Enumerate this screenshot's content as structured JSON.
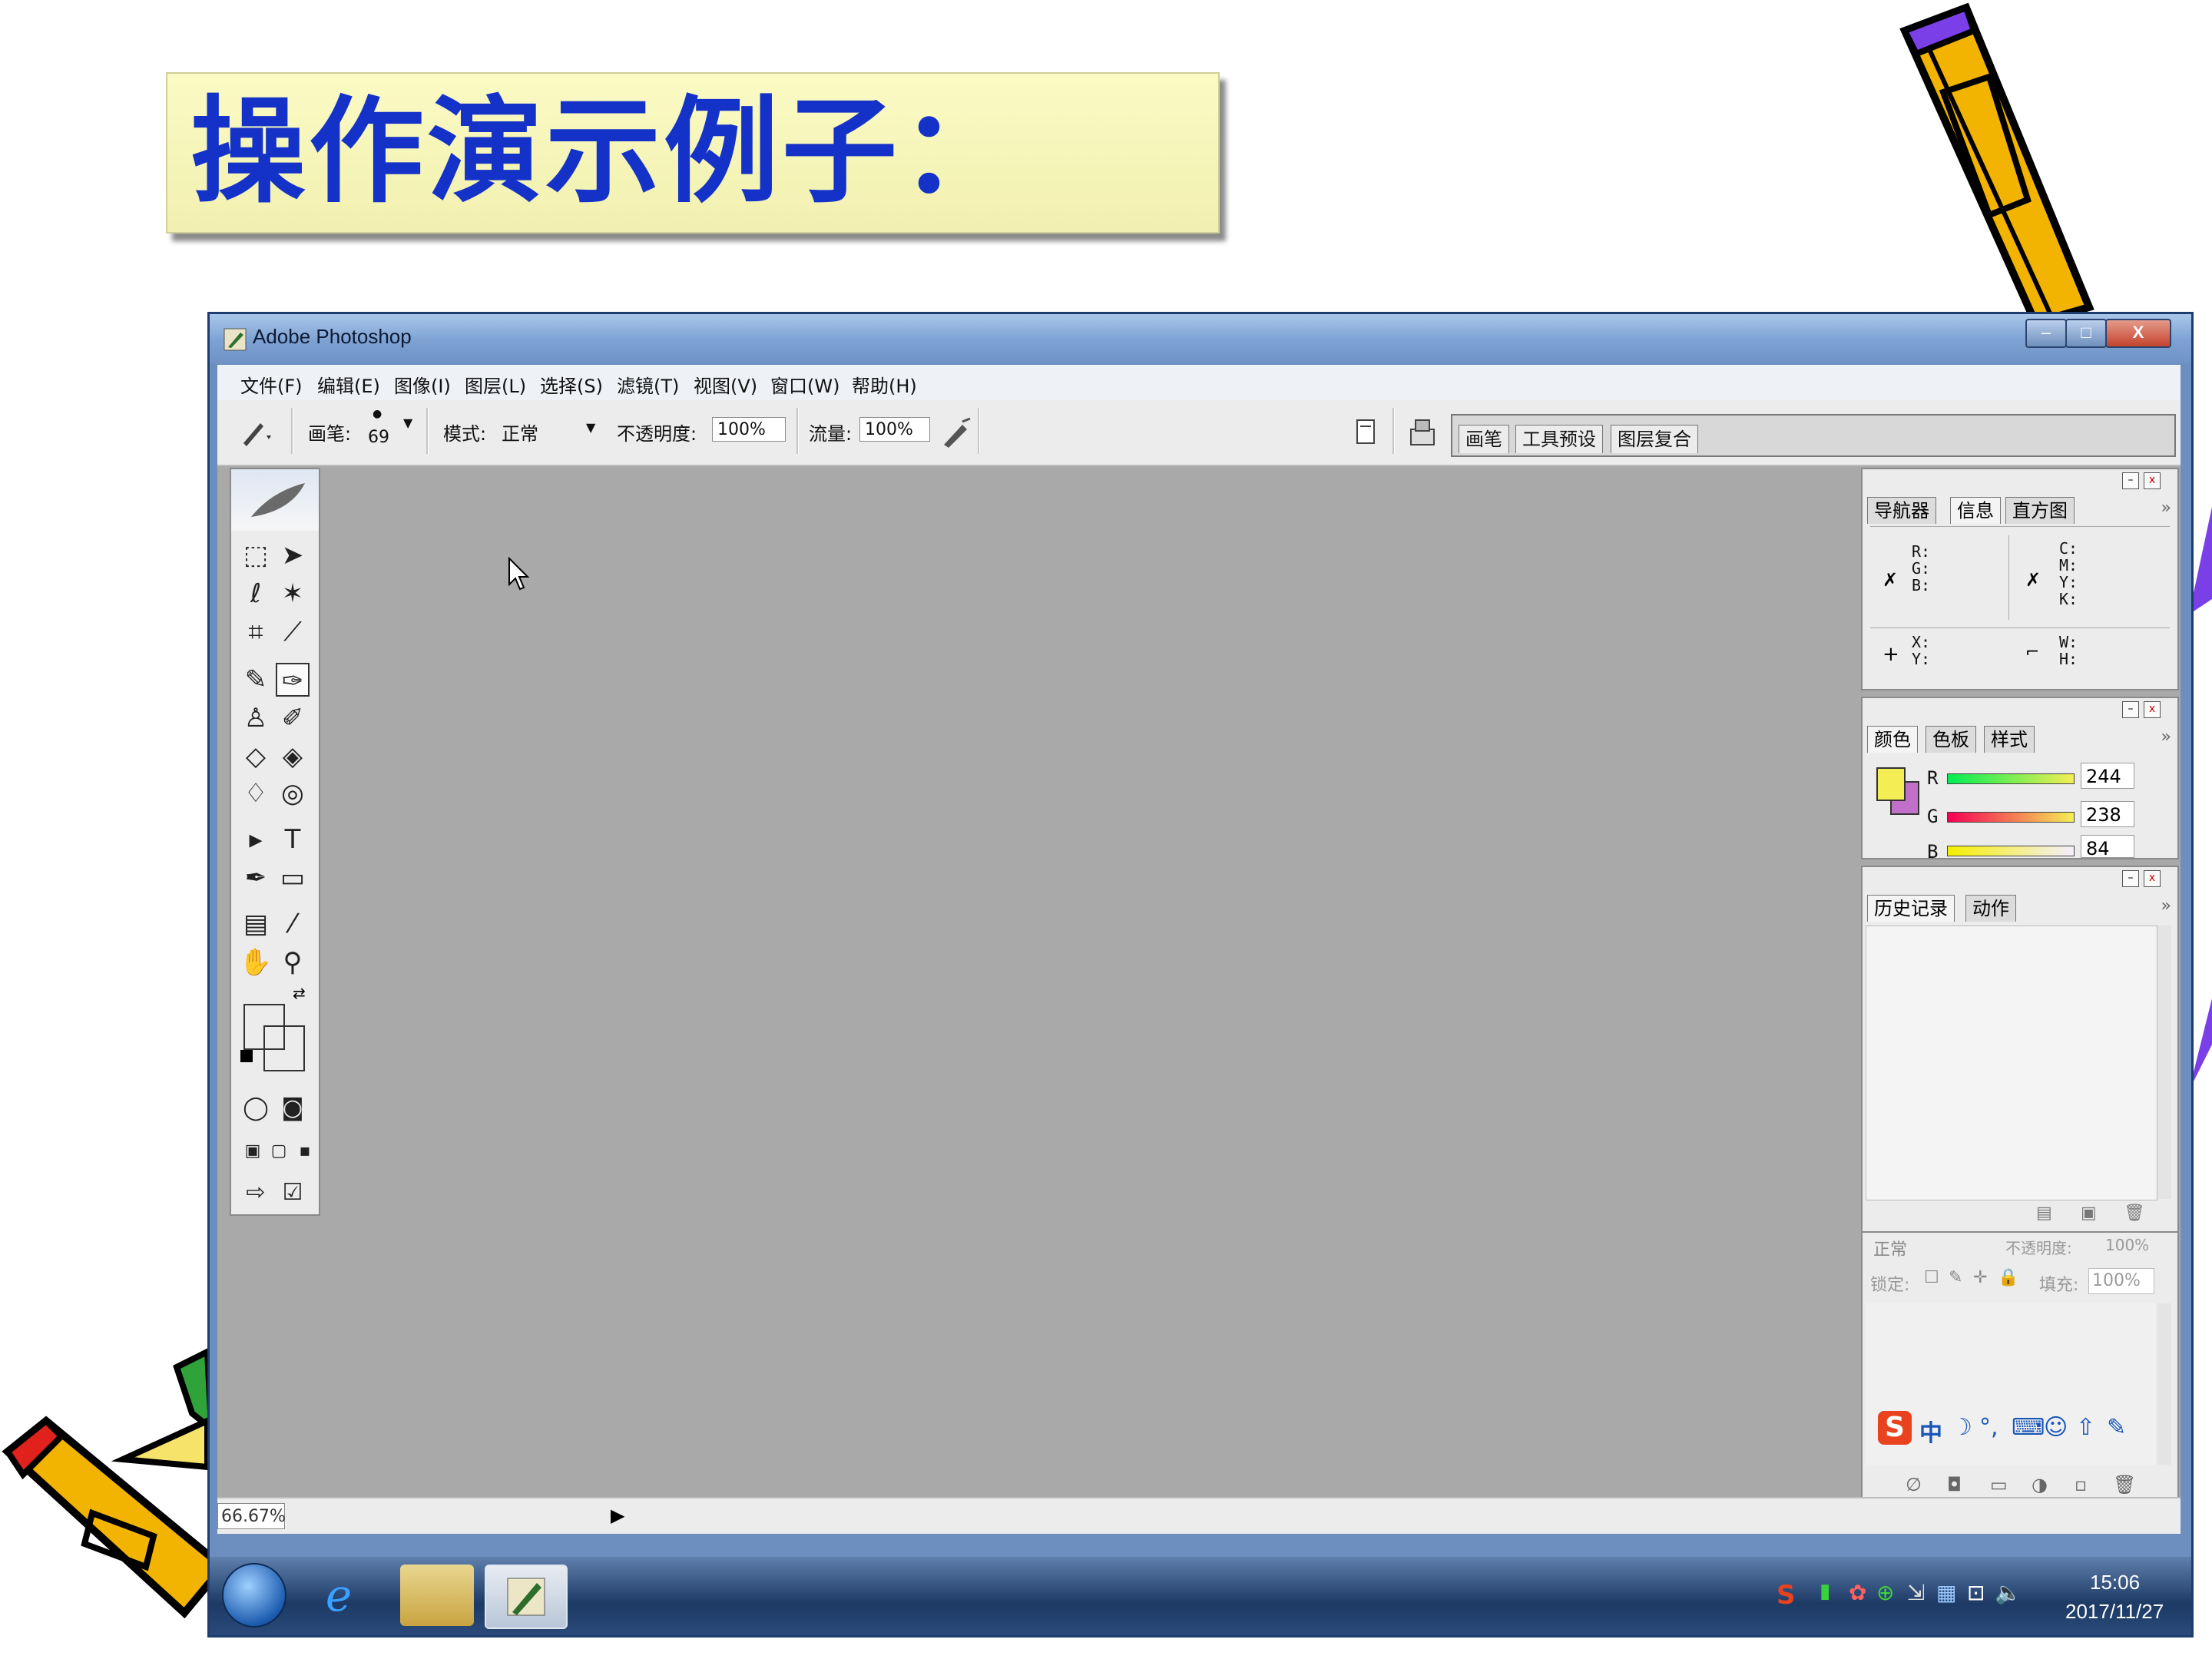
{
  "slide": {
    "title": "操作演示例子："
  },
  "window": {
    "title": "Adobe Photoshop",
    "minimize": "–",
    "maximize": "□",
    "close": "X"
  },
  "menu": [
    "文件(F)",
    "编辑(E)",
    "图像(I)",
    "图层(L)",
    "选择(S)",
    "滤镜(T)",
    "视图(V)",
    "窗口(W)",
    "帮助(H)"
  ],
  "options": {
    "brush_label": "画笔:",
    "brush_size": "69",
    "mode_label": "模式:",
    "mode_value": "正常",
    "opacity_label": "不透明度:",
    "opacity_value": "100%",
    "flow_label": "流量:",
    "flow_value": "100%",
    "dock_tabs": [
      "画笔",
      "工具预设",
      "图层复合"
    ]
  },
  "info_panel": {
    "tabs": [
      "导航器",
      "信息",
      "直方图"
    ],
    "rgb": "R:\nG:\nB:",
    "cmyk": "C:\nM:\nY:\nK:",
    "xy": "X:\nY:",
    "wh": "W:\nH:"
  },
  "color_panel": {
    "tabs": [
      "颜色",
      "色板",
      "样式"
    ],
    "channels": [
      {
        "name": "R",
        "value": "244"
      },
      {
        "name": "G",
        "value": "238"
      },
      {
        "name": "B",
        "value": "84"
      }
    ],
    "foreground": "#f4ee54",
    "background": "#c070c8"
  },
  "history_panel": {
    "tabs": [
      "历史记录",
      "动作"
    ]
  },
  "layers_panel": {
    "blend": "正常",
    "opacity_label": "不透明度:",
    "opacity_value": "100%",
    "lock_label": "锁定:",
    "fill_label": "填充:",
    "fill_value": "100%",
    "ime_label": "中"
  },
  "status": {
    "zoom": "66.67%"
  },
  "taskbar": {
    "time": "15:06",
    "date": "2017/11/27"
  }
}
